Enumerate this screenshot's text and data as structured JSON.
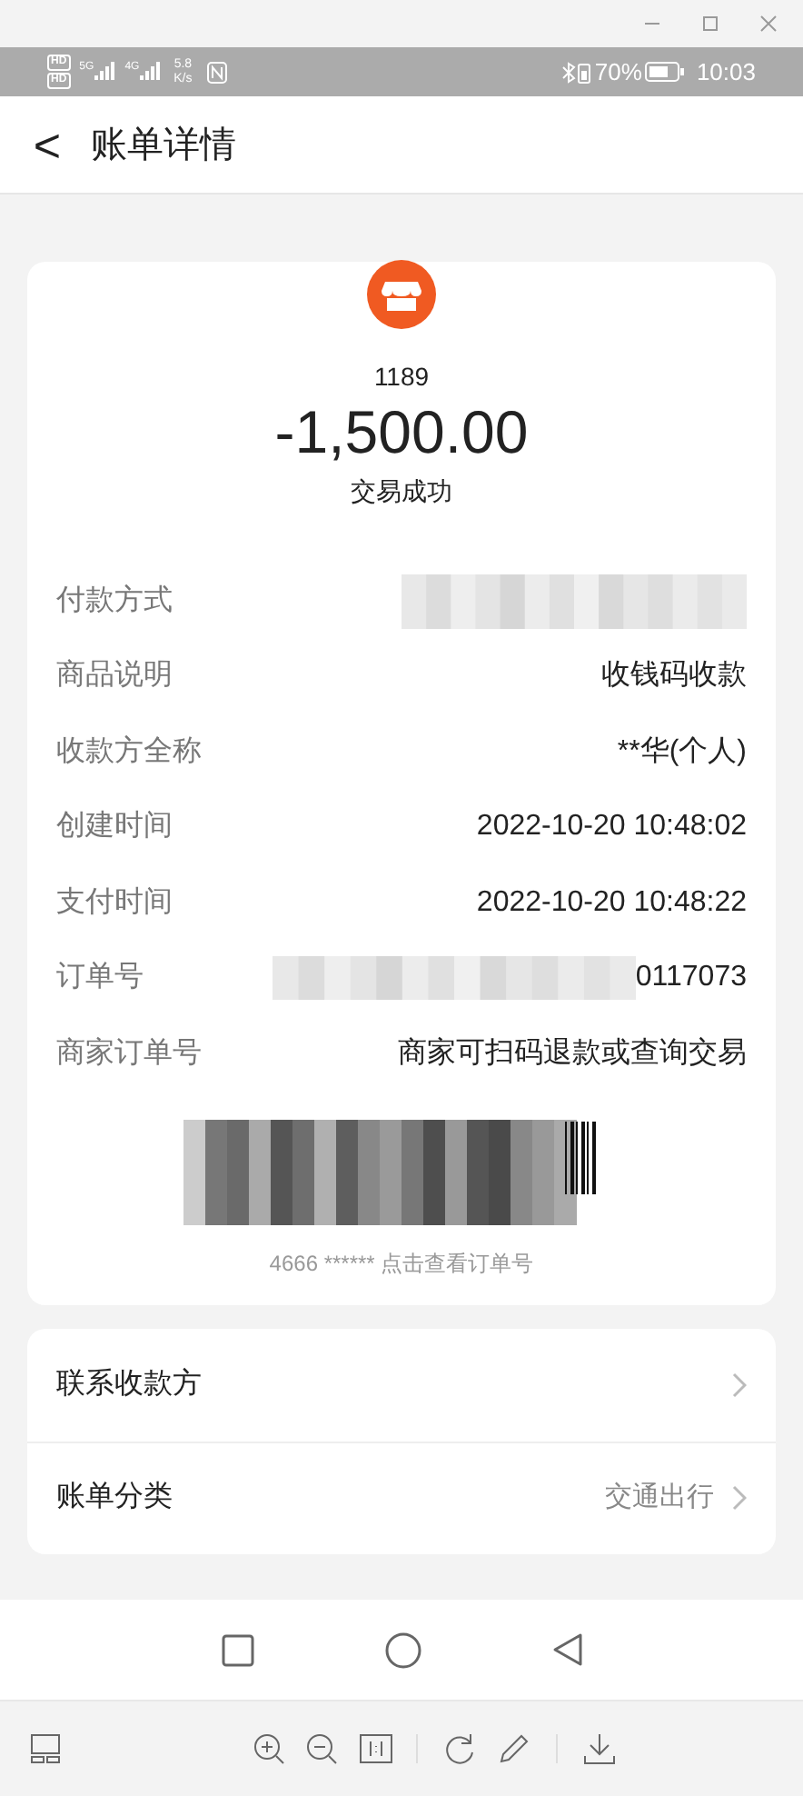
{
  "status_bar": {
    "sim_badges": [
      "HD",
      "HD"
    ],
    "networks": [
      "5G",
      "4G"
    ],
    "speed": "5.8 K/s",
    "battery": "70%",
    "time": "10:03"
  },
  "header": {
    "back": "<",
    "title": "账单详情"
  },
  "summary": {
    "merchant": "1189",
    "amount": "-1,500.00",
    "status": "交易成功"
  },
  "fields": [
    {
      "kind": "blurred",
      "label": "付款方式"
    },
    {
      "kind": "text",
      "label": "商品说明",
      "value": "收钱码收款"
    },
    {
      "kind": "text",
      "label": "收款方全称",
      "value": "**华(个人)"
    },
    {
      "kind": "text",
      "label": "创建时间",
      "value": "2022-10-20 10:48:02"
    },
    {
      "kind": "text",
      "label": "支付时间",
      "value": "2022-10-20 10:48:22"
    },
    {
      "kind": "partial",
      "label": "订单号",
      "value": "0117073"
    },
    {
      "kind": "text",
      "label": "商家订单号",
      "value": "商家可扫码退款或查询交易"
    }
  ],
  "barcode_caption": "4666 ****** 点击查看订单号",
  "links": [
    {
      "label": "联系收款方"
    },
    {
      "label": "账单分类",
      "value": "交通出行"
    }
  ]
}
